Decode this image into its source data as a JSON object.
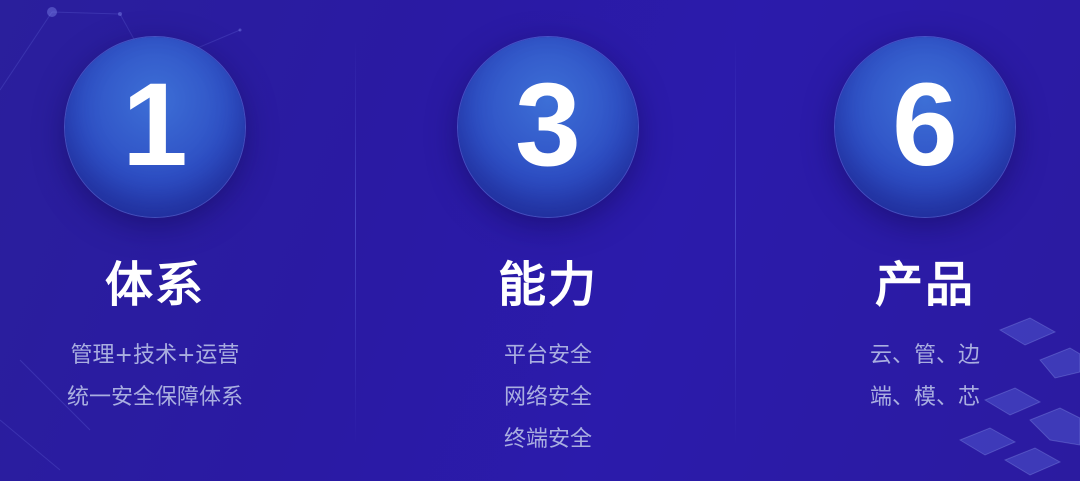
{
  "colors": {
    "background": "#2a1aa3",
    "circle": "#3560d0",
    "title_text": "#ffffff",
    "subtitle_text": "#a9aee0"
  },
  "columns": [
    {
      "number": "1",
      "title": "体系",
      "lines": [
        "管理+技术+运营",
        "统一安全保障体系"
      ]
    },
    {
      "number": "3",
      "title": "能力",
      "lines": [
        "平台安全",
        "网络安全",
        "终端安全"
      ]
    },
    {
      "number": "6",
      "title": "产品",
      "lines": [
        "云、管、边",
        "端、模、芯"
      ]
    }
  ]
}
